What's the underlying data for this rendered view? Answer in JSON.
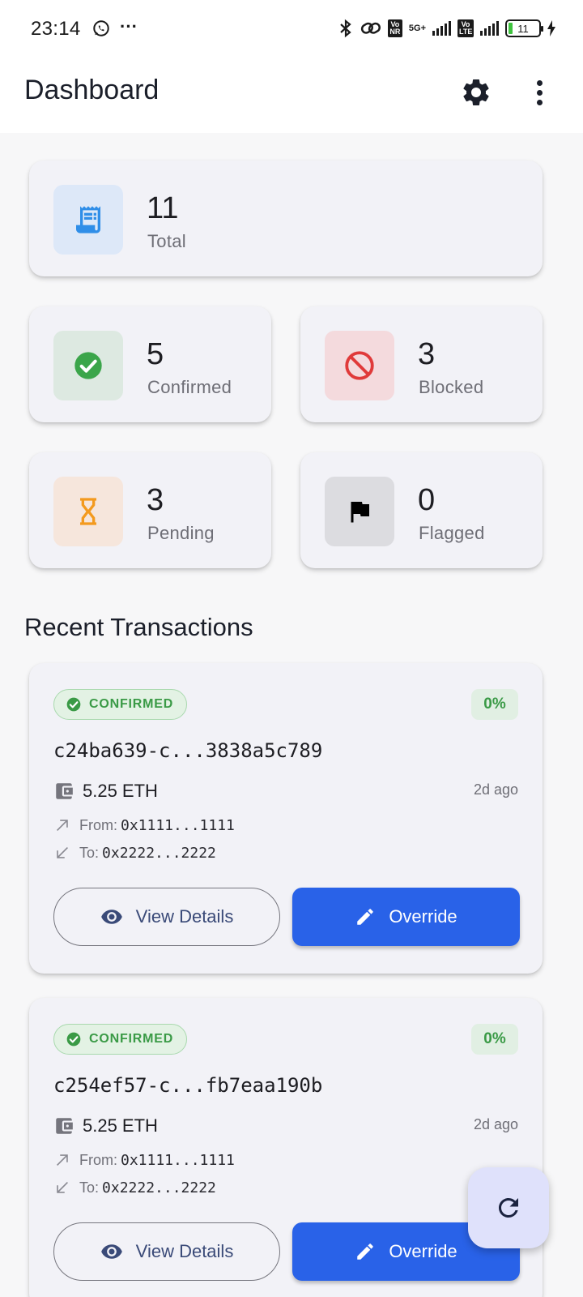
{
  "status_bar": {
    "time": "23:14",
    "dots": "···",
    "network": "5G+",
    "sim1_tag": "Vo NR",
    "sim2_tag": "Vo LTE",
    "battery_level": "11"
  },
  "app_bar": {
    "title": "Dashboard",
    "settings_icon": "gear-icon",
    "more_icon": "more-vertical-icon"
  },
  "stats": {
    "total": {
      "value": "11",
      "label": "Total",
      "icon": "receipt-icon",
      "icon_bg": "#dde8f8",
      "icon_color": "#2f8ee8"
    },
    "confirmed": {
      "value": "5",
      "label": "Confirmed",
      "icon": "check-circle-icon",
      "icon_bg": "#dde9e1",
      "icon_color": "#3ba54a"
    },
    "blocked": {
      "value": "3",
      "label": "Blocked",
      "icon": "block-icon",
      "icon_bg": "#f4dadd",
      "icon_color": "#e03a3a"
    },
    "pending": {
      "value": "3",
      "label": "Pending",
      "icon": "hourglass-icon",
      "icon_bg": "#f6e6dc",
      "icon_color": "#f39a1e"
    },
    "flagged": {
      "value": "0",
      "label": "Flagged",
      "icon": "flag-icon",
      "icon_bg": "#dcdce0",
      "icon_color": "#000000"
    }
  },
  "recent": {
    "title": "Recent Transactions",
    "transactions": [
      {
        "status": "CONFIRMED",
        "risk": "0%",
        "id": "c24ba639-c...3838a5c789",
        "amount": "5.25 ETH",
        "time_ago": "2d ago",
        "from_label": "From:",
        "from": "0x1111...1111",
        "to_label": "To:",
        "to": "0x2222...2222",
        "view_label": "View Details",
        "override_label": "Override"
      },
      {
        "status": "CONFIRMED",
        "risk": "0%",
        "id": "c254ef57-c...fb7eaa190b",
        "amount": "5.25 ETH",
        "time_ago": "2d ago",
        "from_label": "From:",
        "from": "0x1111...1111",
        "to_label": "To:",
        "to": "0x2222...2222",
        "view_label": "View Details",
        "override_label": "Override"
      }
    ]
  },
  "fab": {
    "icon": "refresh-icon"
  },
  "colors": {
    "primary": "#2962e8",
    "success": "#3a9a46",
    "card_bg": "#f2f2f7",
    "page_bg": "#f7f7f8"
  }
}
